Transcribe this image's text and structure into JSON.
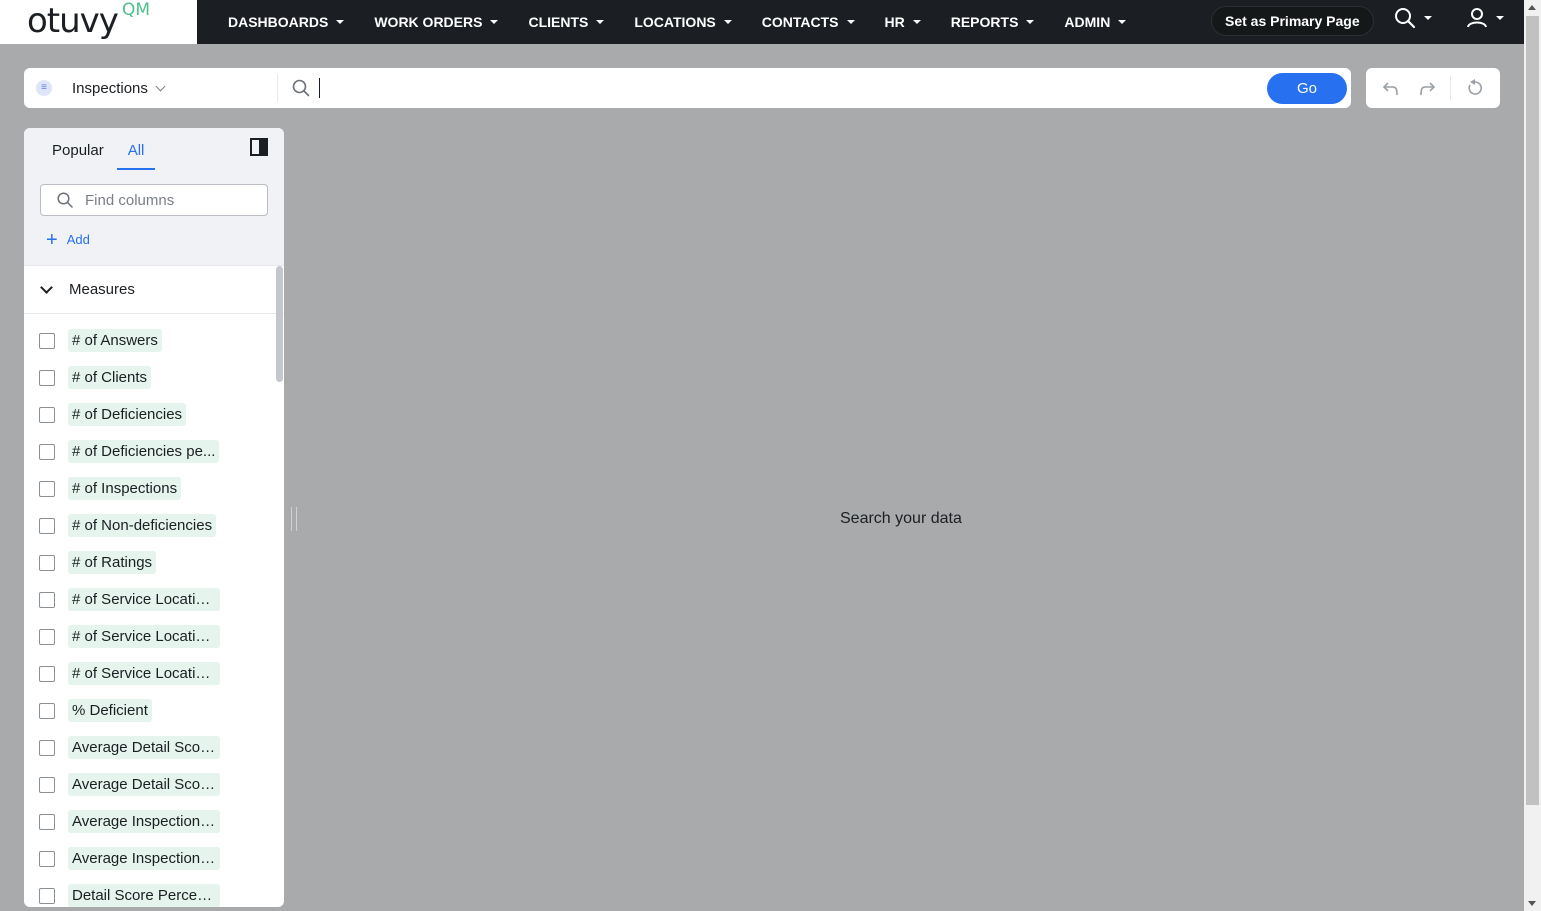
{
  "logo": {
    "text": "otuvy",
    "sup": "QM"
  },
  "nav": {
    "items": [
      {
        "label": "DASHBOARDS"
      },
      {
        "label": "WORK ORDERS"
      },
      {
        "label": "CLIENTS"
      },
      {
        "label": "LOCATIONS"
      },
      {
        "label": "CONTACTS"
      },
      {
        "label": "HR"
      },
      {
        "label": "REPORTS"
      },
      {
        "label": "ADMIN"
      }
    ],
    "primary_page_label": "Set as Primary Page"
  },
  "search": {
    "datasource": "Inspections",
    "go_label": "Go",
    "placeholder": ""
  },
  "panel": {
    "tabs": [
      "Popular",
      "All"
    ],
    "active_tab": "All",
    "find_placeholder": "Find columns",
    "add_label": "Add",
    "group_label": "Measures",
    "columns": [
      "# of Answers",
      "# of Clients",
      "# of Deficiencies",
      "# of Deficiencies pe...",
      "# of Inspections",
      "# of Non-deficiencies",
      "# of Ratings",
      "# of Service Locations",
      "# of Service Locatio...",
      "# of Service Locatio...",
      "% Deficient",
      "Average Detail Scor...",
      "Average Detail Scor...",
      "Average Inspection ...",
      "Average Inspection ...",
      "Detail Score Percent..."
    ]
  },
  "main": {
    "empty_message": "Search your data"
  },
  "colors": {
    "accent": "#2770ef",
    "chip": "#e5f4ec",
    "topbar": "#1b1f23",
    "logo_accent": "#4fc08d"
  }
}
